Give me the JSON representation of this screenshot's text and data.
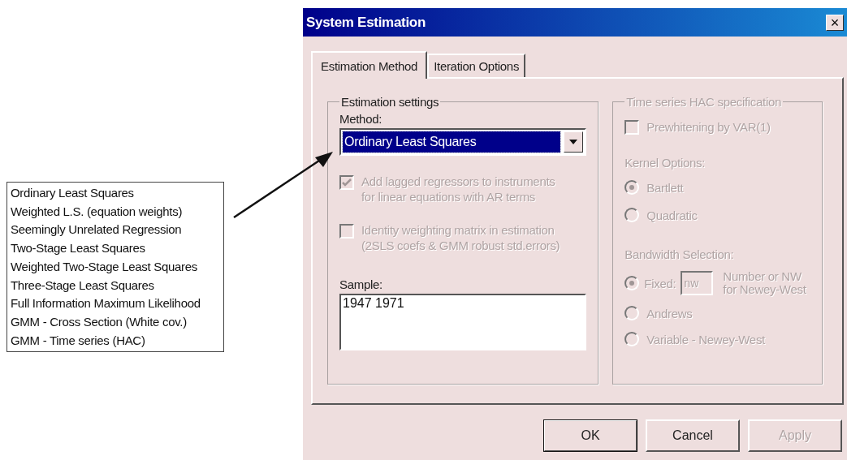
{
  "callout": {
    "items": [
      "Ordinary Least Squares",
      "Weighted L.S. (equation weights)",
      "Seemingly Unrelated Regression",
      "Two-Stage Least Squares",
      "Weighted Two-Stage Least Squares",
      "Three-Stage Least Squares",
      "Full Information Maximum Likelihood",
      "GMM - Cross Section (White cov.)",
      "GMM - Time series (HAC)"
    ]
  },
  "dialog": {
    "title": "System Estimation",
    "close": "×",
    "tabs": [
      {
        "label": "Estimation Method",
        "selected": true
      },
      {
        "label": "Iteration Options",
        "selected": false
      }
    ],
    "estimation_settings": {
      "title": "Estimation settings",
      "method_label": "Method:",
      "method_value": "Ordinary Least Squares",
      "options": [
        {
          "lines": [
            "Add lagged regressors to instruments",
            "for linear equations with AR terms"
          ],
          "checked": true,
          "disabled": true
        },
        {
          "lines": [
            "Identity weighting matrix in estimation",
            "(2SLS coefs & GMM robust std.errors)"
          ],
          "checked": false,
          "disabled": true
        }
      ],
      "sample_label": "Sample:",
      "sample_value": "1947 1971"
    },
    "hac": {
      "title": "Time series HAC specification",
      "disabled": true,
      "prewhitening": {
        "label": "Prewhitening by VAR(1)",
        "checked": false
      },
      "kernel_label": "Kernel Options:",
      "kernel_options": [
        {
          "label": "Bartlett",
          "selected": true
        },
        {
          "label": "Quadratic",
          "selected": false
        }
      ],
      "bandwidth_label": "Bandwidth Selection:",
      "bandwidth_options": [
        {
          "kind": "fixed",
          "label": "Fixed:",
          "selected": true,
          "field_value": "nw",
          "note": [
            "Number or NW",
            "for Newey-West"
          ]
        },
        {
          "kind": "plain",
          "label": "Andrews",
          "selected": false
        },
        {
          "kind": "plain",
          "label": "Variable - Newey-West",
          "selected": false
        }
      ]
    },
    "buttons": [
      {
        "label": "OK",
        "default": true,
        "disabled": false
      },
      {
        "label": "Cancel",
        "default": false,
        "disabled": false
      },
      {
        "label": "Apply",
        "default": false,
        "disabled": true
      }
    ]
  }
}
